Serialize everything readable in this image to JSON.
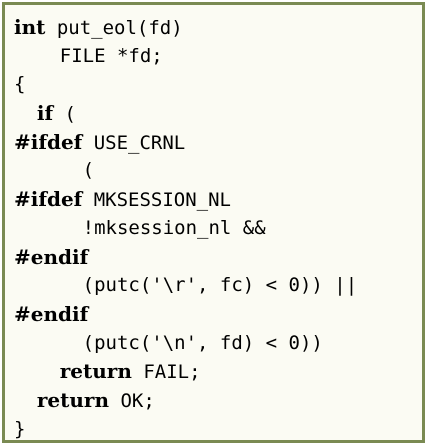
{
  "code_lines": [
    {
      "indent": "",
      "kw": "int",
      "rest": " put_eol(fd)"
    },
    {
      "indent": "    ",
      "kw": "",
      "rest": "FILE *fd;"
    },
    {
      "indent": "",
      "kw": "",
      "rest": "{"
    },
    {
      "indent": "  ",
      "kw": "if",
      "rest": " ("
    },
    {
      "indent": "",
      "kw": "#ifdef",
      "rest": " USE_CRNL"
    },
    {
      "indent": "    ",
      "kw": "",
      "rest": "  ("
    },
    {
      "indent": "",
      "kw": "#ifdef",
      "rest": " MKSESSION_NL"
    },
    {
      "indent": "      ",
      "kw": "",
      "rest": "!mksession_nl &&"
    },
    {
      "indent": "",
      "kw": "#endif",
      "rest": ""
    },
    {
      "indent": "      ",
      "kw": "",
      "rest": "(putc('\\r', fc) < 0)) ||"
    },
    {
      "indent": "",
      "kw": "#endif",
      "rest": ""
    },
    {
      "indent": "      ",
      "kw": "",
      "rest": "(putc('\\n', fd) < 0))"
    },
    {
      "indent": "    ",
      "kw": "return",
      "rest": " FAIL;"
    },
    {
      "indent": "  ",
      "kw": "return",
      "rest": " OK;"
    },
    {
      "indent": "",
      "kw": "",
      "rest": "}"
    }
  ]
}
